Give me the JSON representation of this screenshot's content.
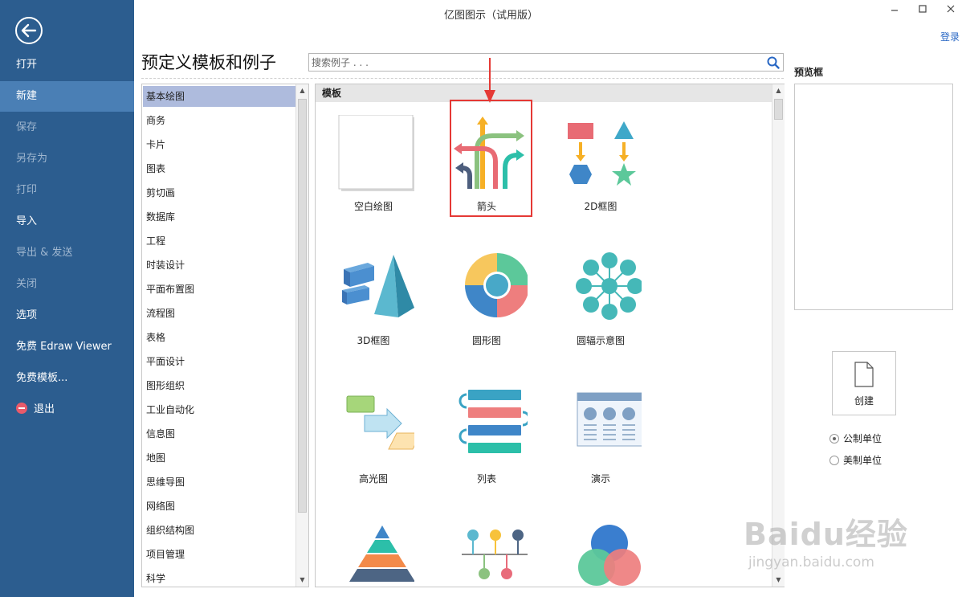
{
  "window": {
    "title": "亿图图示（试用版）",
    "login": "登录"
  },
  "nav": {
    "items": [
      {
        "label": "打开"
      },
      {
        "label": "新建"
      },
      {
        "label": "保存"
      },
      {
        "label": "另存为"
      },
      {
        "label": "打印"
      },
      {
        "label": "导入"
      },
      {
        "label": "导出 & 发送"
      },
      {
        "label": "关闭"
      },
      {
        "label": "选项"
      },
      {
        "label": "免费 Edraw Viewer"
      },
      {
        "label": "免费模板..."
      },
      {
        "label": "退出"
      }
    ],
    "active": "新建"
  },
  "main": {
    "heading": "预定义模板和例子",
    "search_placeholder": "搜索例子 . . .",
    "categories": [
      "基本绘图",
      "商务",
      "卡片",
      "图表",
      "剪切画",
      "数据库",
      "工程",
      "时装设计",
      "平面布置图",
      "流程图",
      "表格",
      "平面设计",
      "图形组织",
      "工业自动化",
      "信息图",
      "地图",
      "思维导图",
      "网络图",
      "组织结构图",
      "项目管理",
      "科学"
    ],
    "selected_category": "基本绘图",
    "templates_header": "模板",
    "templates": [
      {
        "label": "空白绘图"
      },
      {
        "label": "箭头"
      },
      {
        "label": "2D框图"
      },
      {
        "label": "3D框图"
      },
      {
        "label": "圆形图"
      },
      {
        "label": "圆辐示意图"
      },
      {
        "label": "高光图"
      },
      {
        "label": "列表"
      },
      {
        "label": "演示"
      }
    ],
    "highlighted_template": "箭头"
  },
  "preview": {
    "label": "预览框",
    "create_label": "创建",
    "units": [
      {
        "label": "公制单位",
        "selected": true
      },
      {
        "label": "美制单位",
        "selected": false
      }
    ]
  },
  "watermark": {
    "brand": "Baidu经验",
    "url": "jingyan.baidu.com"
  },
  "colors": {
    "sidebar": "#2c5d8f",
    "sidebar_active": "#4a7fb5",
    "selection": "#aebbdd",
    "highlight_red": "#e53935",
    "link_blue": "#2867c4"
  },
  "icons": [
    "back-arrow-icon",
    "search-icon",
    "minimize-icon",
    "maximize-icon",
    "close-icon",
    "new-document-icon",
    "exit-icon"
  ]
}
